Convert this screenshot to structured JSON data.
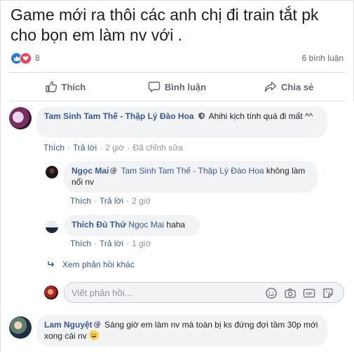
{
  "post": {
    "text": "Game mới ra thôi các anh chị đi train tắt pk cho bọn em làm nv với .",
    "reaction_count": "8",
    "reaction_icons": [
      "like-icon",
      "love-icon"
    ],
    "comment_count": "6 bình luận"
  },
  "actions": {
    "like": "Thích",
    "comment": "Bình luận",
    "share": "Chia sẻ"
  },
  "comments": [
    {
      "author": "Tam Sinh Tam Thế - Thập Lý Đào Hoa",
      "badge": "shield-icon",
      "text": "Ahihi kịch tính quá đi mất ^^",
      "meta": {
        "like": "Thích",
        "reply": "Trả lời",
        "time": "2 giờ",
        "edited": "Đã chỉnh sửa"
      }
    },
    {
      "author": "Ngọc Mai",
      "mention": "Tam Sinh Tam Thế - Thập Lý Đào Hoa",
      "text": "không làm nổi nv",
      "meta": {
        "like": "Thích",
        "reply": "Trả lời",
        "time": "2 giờ"
      }
    },
    {
      "author": "Thích Đủ Thứ",
      "mention": "Ngọc Mai",
      "text": "haha",
      "meta": {
        "like": "Thích",
        "reply": "Trả lời",
        "time": "1 giờ"
      }
    },
    {
      "author": "Lam Nguyệt",
      "text": "Sáng giờ em làm nv mà toàn bị ks đứng đợi tầm 30p mới xong cái nv"
    }
  ],
  "more_replies": "Xem phản hồi khác",
  "reply_box": {
    "placeholder": "Viết phản hồi..."
  },
  "colors": {
    "link_blue": "#385898",
    "like_blue": "#1877f2",
    "love_red": "#f33e58",
    "bubble_gray": "#f2f3f5",
    "muted": "#90949c"
  }
}
